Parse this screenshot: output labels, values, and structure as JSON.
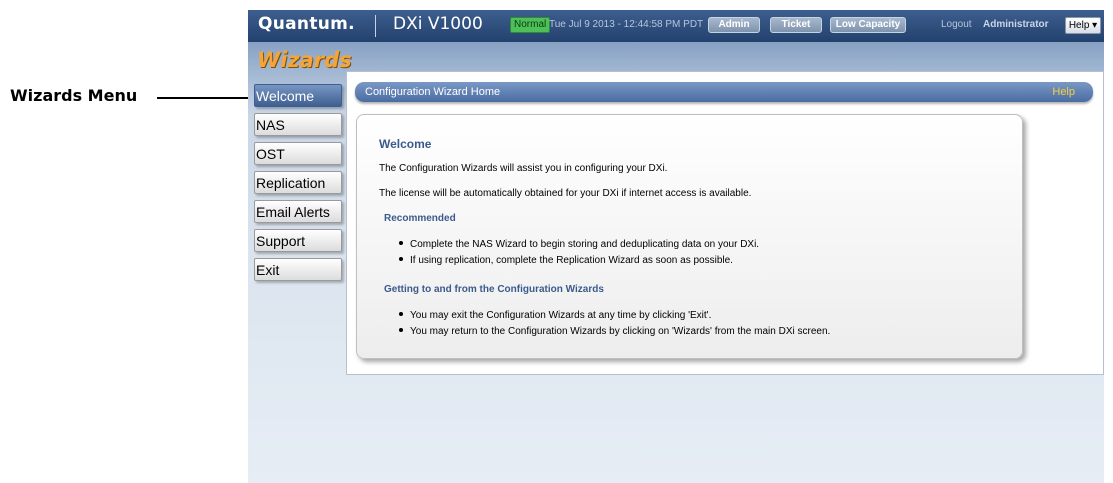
{
  "annotation": {
    "label": "Wizards Menu"
  },
  "header": {
    "brand": "Quantum.",
    "product": "DXi V1000",
    "status": "Normal",
    "datetime": "Tue Jul 9 2013 - 12:44:58 PM PDT",
    "buttons": {
      "admin": "Admin",
      "ticket": "Ticket",
      "capacity": "Low Capacity"
    },
    "logout": "Logout",
    "user": "Administrator",
    "help": "Help ▾"
  },
  "page_title": "Wizards",
  "menu": [
    {
      "label": "Welcome",
      "active": true
    },
    {
      "label": "NAS"
    },
    {
      "label": "OST"
    },
    {
      "label": "Replication"
    },
    {
      "label": "Email Alerts"
    },
    {
      "label": "Support"
    },
    {
      "label": "Exit"
    }
  ],
  "content": {
    "title": "Configuration Wizard Home",
    "help": "Help",
    "heading": "Welcome",
    "para1": "The Configuration Wizards will assist you in configuring your DXi.",
    "para2": "The license will be automatically obtained for your DXi if internet access is available.",
    "recommended_heading": "Recommended",
    "recommended": [
      "Complete the NAS Wizard to begin storing and deduplicating data on your DXi.",
      "If using replication, complete the Replication Wizard as soon as possible."
    ],
    "getting_heading": "Getting to and from the Configuration Wizards",
    "getting": [
      "You may exit the Configuration Wizards at any time by clicking 'Exit'.",
      "You may return to the Configuration Wizards by clicking on 'Wizards' from the main DXi screen."
    ]
  }
}
